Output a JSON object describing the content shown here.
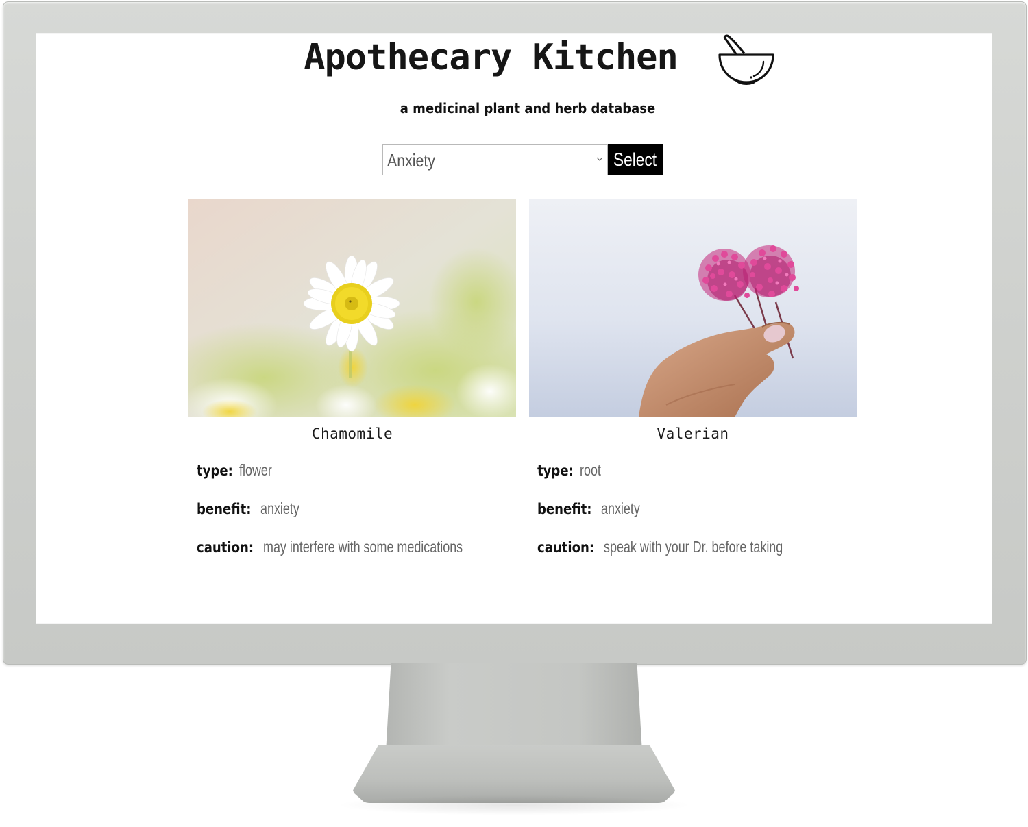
{
  "site": {
    "title": "Apothecary Kitchen",
    "logo_icon": "mortar-and-pestle-icon",
    "subtitle": "a medicinal plant and herb database"
  },
  "filter": {
    "selected": "Anxiety",
    "button_label": "Select"
  },
  "colors": {
    "button_bg": "#000000",
    "text": "#111111",
    "muted_text": "#666666"
  },
  "labels": {
    "type": "type:",
    "benefit": "benefit:",
    "caution": "caution:"
  },
  "plants": [
    {
      "name": "Chamomile",
      "image": "chamomile-flower-photo",
      "type": "flower",
      "benefit": "anxiety",
      "caution": "may interfere with some medications"
    },
    {
      "name": "Valerian",
      "image": "valerian-flower-in-hand-photo",
      "type": "root",
      "benefit": "anxiety",
      "caution": "speak with your Dr. before taking"
    }
  ]
}
